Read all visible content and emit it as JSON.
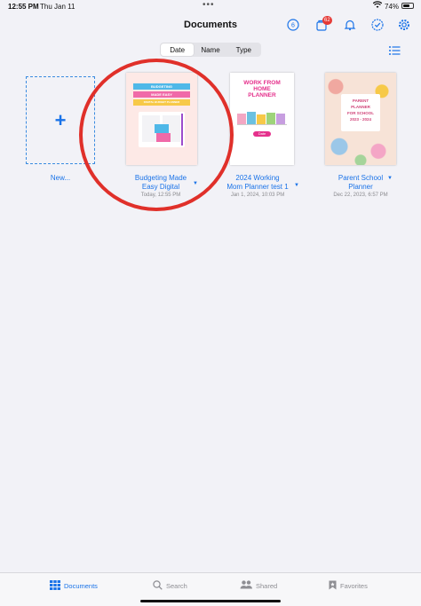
{
  "status": {
    "time": "12:55 PM",
    "date": "Thu Jan 11",
    "battery": "74%",
    "battery_level": 0.74
  },
  "nav": {
    "title": "Documents",
    "badge_count": "62",
    "timer_value": "6"
  },
  "sort": {
    "options": [
      "Date",
      "Name",
      "Type"
    ],
    "selected": "Date"
  },
  "new_tile": {
    "plus": "+",
    "label": "New..."
  },
  "documents": [
    {
      "title_line1": "Budgeting Made",
      "title_line2": "Easy Digital",
      "subtitle": "Today, 12:55 PM",
      "cover_bands": [
        "BUDGETING",
        "MADE EASY",
        "DIGITAL BUDGET PLANNER"
      ],
      "cover_colors": [
        "#4fb8e8",
        "#f06aa8",
        "#f7c948"
      ]
    },
    {
      "title_line1": "2024 Working",
      "title_line2": "Mom Planner test 1",
      "subtitle": "Jan 1, 2024, 10:03 PM",
      "cover_lines": [
        "WORK FROM",
        "HOME",
        "PLANNER"
      ],
      "cover_button": "Date"
    },
    {
      "title_line1": "Parent School",
      "title_line2": "Planner",
      "subtitle": "Dec 22, 2023, 6:57 PM",
      "cover_lines": [
        "PARENT",
        "PLANNER",
        "FOR SCHOOL",
        "2023 - 2024"
      ]
    }
  ],
  "tabs": [
    {
      "label": "Documents",
      "icon": "grid-icon",
      "active": true
    },
    {
      "label": "Search",
      "icon": "search-icon"
    },
    {
      "label": "Shared",
      "icon": "people-icon"
    },
    {
      "label": "Favorites",
      "icon": "bookmark-icon"
    }
  ],
  "colors": {
    "accent": "#1a73e8",
    "annotation": "#e0302a",
    "badge": "#e53935"
  }
}
